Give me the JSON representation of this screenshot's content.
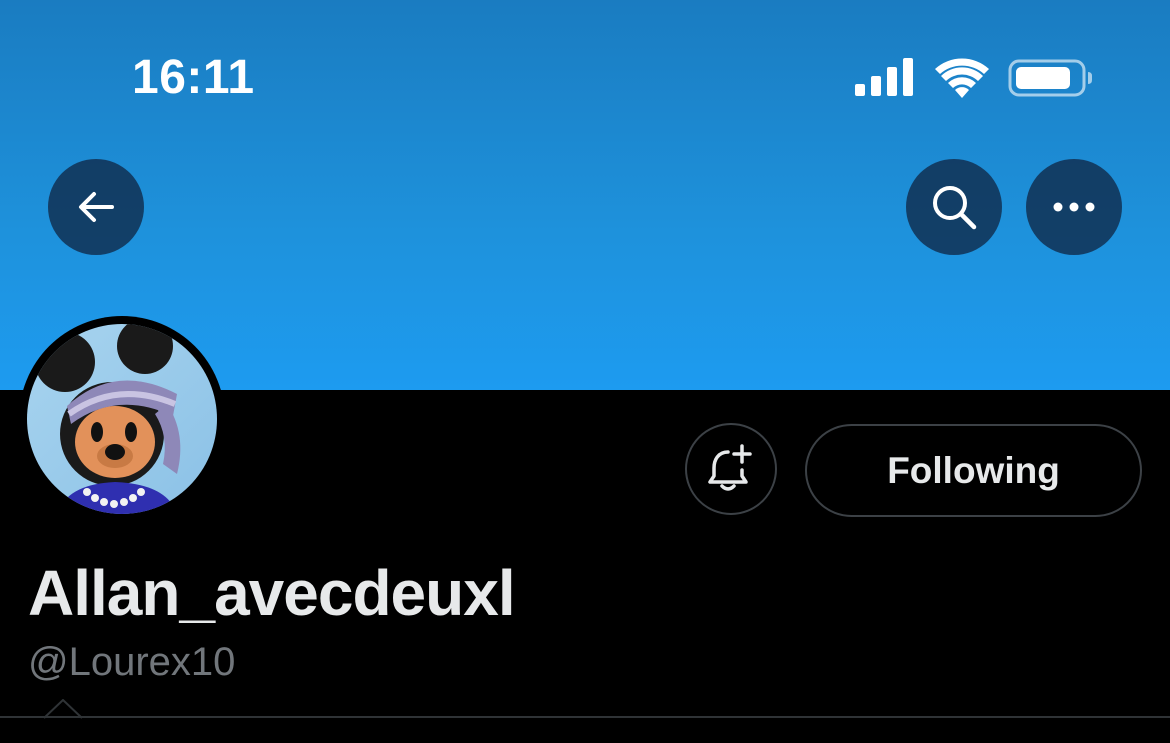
{
  "status_bar": {
    "time": "16:11",
    "icons": [
      "signal-icon",
      "wifi-icon",
      "battery-icon"
    ]
  },
  "header": {
    "buttons": [
      "back-arrow-icon",
      "search-icon",
      "more-icon"
    ]
  },
  "profile": {
    "display_name": "Allan_avecdeuxl",
    "handle": "@Lourex10",
    "following_label": "Following",
    "notify_icon": "bell-plus-icon"
  },
  "colors": {
    "banner": "#1d9bf0",
    "background": "#000000",
    "text_primary": "#e7e9ea",
    "text_secondary": "#71767b",
    "border": "#3c4146"
  }
}
